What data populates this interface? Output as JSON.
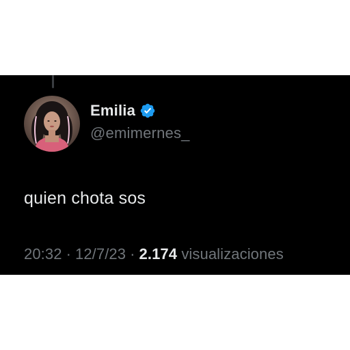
{
  "tweet": {
    "author": {
      "display_name": "Emilia",
      "handle": "@emimernes_",
      "verified": true,
      "verified_icon": "verified-badge-icon",
      "verified_color": "#1d9bf0"
    },
    "text": "quien chota sos",
    "time": "20:32",
    "date": "12/7/23",
    "separator": "·",
    "views_count": "2.174",
    "views_label": "visualizaciones"
  },
  "colors": {
    "card_background": "#000000",
    "page_background": "#ffffff",
    "primary_text": "#e7e9ea",
    "secondary_text": "#71767b"
  }
}
